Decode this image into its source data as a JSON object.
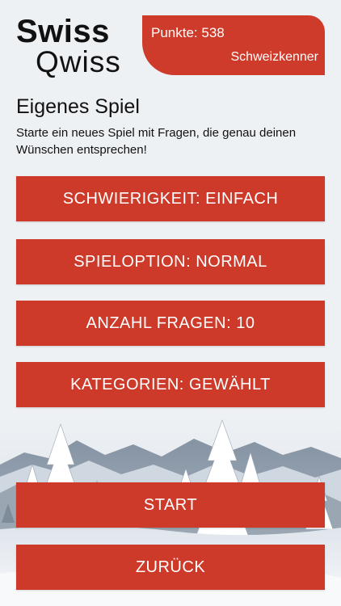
{
  "header": {
    "logo_top": "Swiss",
    "logo_bottom": "Qwiss",
    "points": "Punkte: 538",
    "rank": "Schweizkenner"
  },
  "main": {
    "title": "Eigenes Spiel",
    "description": "Starte ein neues Spiel mit Fragen, die genau deinen Wünschen entsprechen!"
  },
  "options": {
    "difficulty": "SCHWIERIGKEIT: EINFACH",
    "game_option": "SPIELOPTION: NORMAL",
    "question_count": "ANZAHL FRAGEN: 10",
    "categories": "KATEGORIEN: GEWÄHLT"
  },
  "actions": {
    "start": "START",
    "back": "ZURÜCK"
  },
  "colors": {
    "accent": "#cd3a29",
    "background": "#eef1f4"
  }
}
